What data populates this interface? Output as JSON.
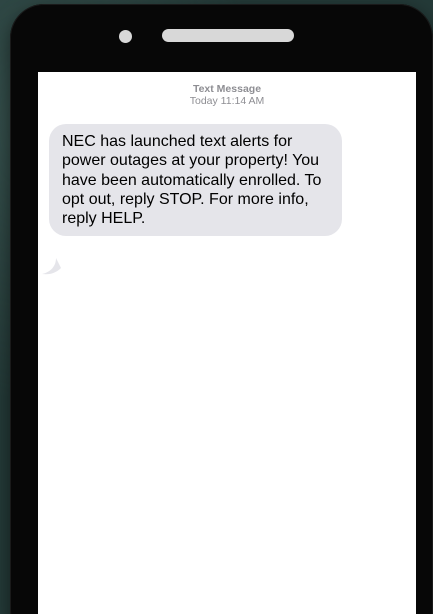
{
  "conversation": {
    "header_label": "Text Message",
    "header_time": "Today 11:14 AM"
  },
  "messages": [
    {
      "direction": "incoming",
      "text": "NEC has launched text alerts for power outages at your property! You have been automatically enrolled. To opt out, reply STOP. For more info, reply HELP."
    }
  ],
  "colors": {
    "background": "#243a38",
    "phone_body": "#070707",
    "screen": "#ffffff",
    "incoming_bubble": "#e5e5ea",
    "timestamp_text": "#8e8e93"
  }
}
